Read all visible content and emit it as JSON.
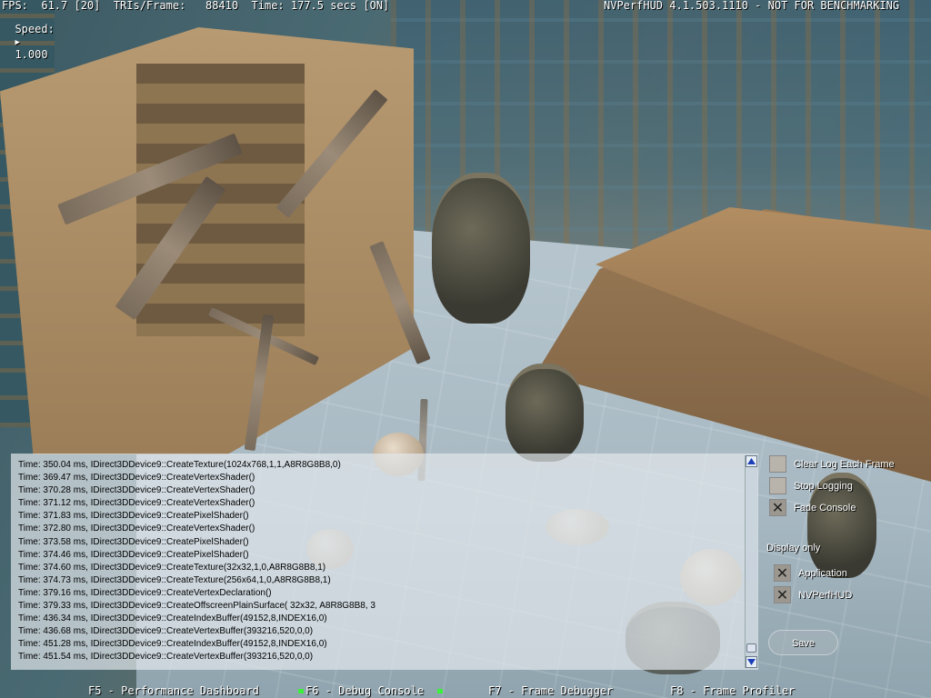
{
  "hud": {
    "stats_line": "FPS:  61.7 [20]  TRIs/Frame:   88410  Time: 177.5 secs [ON]",
    "speed_label": "Speed:",
    "speed_value": "1.000",
    "title": "NVPerfHUD 4.1.503.1110 - NOT FOR BENCHMARKING"
  },
  "console": {
    "lines": [
      "Time: 350.04 ms, IDirect3DDevice9::CreateTexture(1024x768,1,1,A8R8G8B8,0)",
      "Time: 369.47 ms, IDirect3DDevice9::CreateVertexShader()",
      "Time: 370.28 ms, IDirect3DDevice9::CreateVertexShader()",
      "Time: 371.12 ms, IDirect3DDevice9::CreateVertexShader()",
      "Time: 371.83 ms, IDirect3DDevice9::CreatePixelShader()",
      "Time: 372.80 ms, IDirect3DDevice9::CreateVertexShader()",
      "Time: 373.58 ms, IDirect3DDevice9::CreatePixelShader()",
      "Time: 374.46 ms, IDirect3DDevice9::CreatePixelShader()",
      "Time: 374.60 ms, IDirect3DDevice9::CreateTexture(32x32,1,0,A8R8G8B8,1)",
      "Time: 374.73 ms, IDirect3DDevice9::CreateTexture(256x64,1,0,A8R8G8B8,1)",
      "Time: 379.16 ms, IDirect3DDevice9::CreateVertexDeclaration()",
      "Time: 379.33 ms, IDirect3DDevice9::CreateOffscreenPlainSurface( 32x32, A8R8G8B8, 3",
      "Time: 436.34 ms, IDirect3DDevice9::CreateIndexBuffer(49152,8,INDEX16,0)",
      "Time: 436.68 ms, IDirect3DDevice9::CreateVertexBuffer(393216,520,0,0)",
      "Time: 451.28 ms, IDirect3DDevice9::CreateIndexBuffer(49152,8,INDEX16,0)",
      "Time: 451.54 ms, IDirect3DDevice9::CreateVertexBuffer(393216,520,0,0)"
    ]
  },
  "options": {
    "clear_log": {
      "label": "Clear Log Each Frame",
      "checked": false
    },
    "stop_logging": {
      "label": "Stop Logging",
      "checked": false
    },
    "fade_console": {
      "label": "Fade Console",
      "checked": true
    },
    "display_only_label": "Display only",
    "application": {
      "label": "Application",
      "checked": true
    },
    "nvperfhud": {
      "label": "NVPerfHUD",
      "checked": true
    },
    "save_label": "Save"
  },
  "fkeys": {
    "f5": "F5 - Performance Dashboard",
    "f6": "F6 - Debug Console",
    "f7": "F7 - Frame Debugger",
    "f8": "F8 - Frame Profiler"
  },
  "colors": {
    "active_mode_marker": "#3cf03c",
    "hud_text": "#ffffff"
  }
}
